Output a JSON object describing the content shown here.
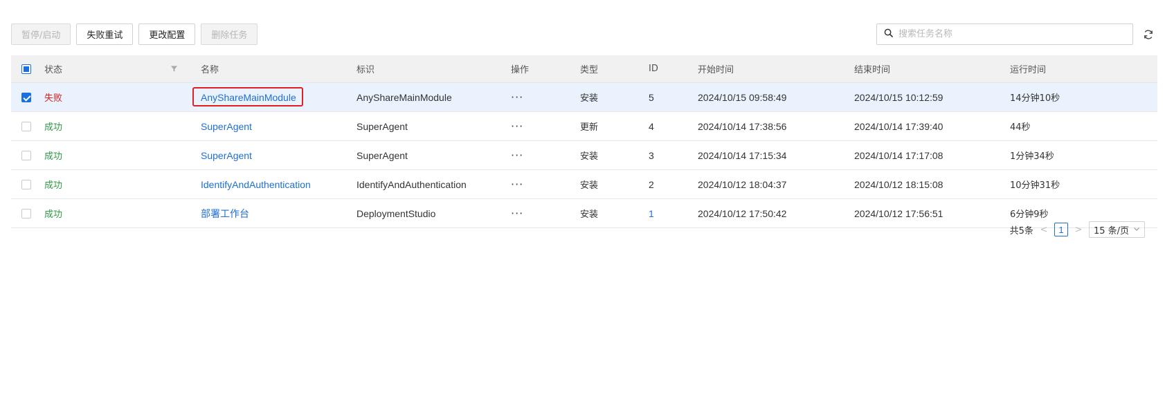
{
  "toolbar": {
    "pause_start_label": "暂停/启动",
    "retry_failed_label": "失败重试",
    "change_config_label": "更改配置",
    "delete_task_label": "删除任务"
  },
  "search": {
    "placeholder": "搜索任务名称",
    "icon": "search-icon"
  },
  "refresh_icon": "refresh-icon",
  "table": {
    "headers": {
      "status": "状态",
      "name": "名称",
      "tag": "标识",
      "operation": "操作",
      "type": "类型",
      "id": "ID",
      "start_time": "开始时间",
      "end_time": "结束时间",
      "run_time": "运行时间"
    },
    "rows": [
      {
        "checked": true,
        "status": "失败",
        "status_kind": "fail",
        "name": "AnyShareMainModule",
        "tag": "AnyShareMainModule",
        "operation": "···",
        "type": "安装",
        "id": "5",
        "start_time": "2024/10/15 09:58:49",
        "end_time": "2024/10/15 10:12:59",
        "run_time": "14分钟10秒"
      },
      {
        "checked": false,
        "status": "成功",
        "status_kind": "ok",
        "name": "SuperAgent",
        "tag": "SuperAgent",
        "operation": "···",
        "type": "更新",
        "id": "4",
        "start_time": "2024/10/14 17:38:56",
        "end_time": "2024/10/14 17:39:40",
        "run_time": "44秒"
      },
      {
        "checked": false,
        "status": "成功",
        "status_kind": "ok",
        "name": "SuperAgent",
        "tag": "SuperAgent",
        "operation": "···",
        "type": "安装",
        "id": "3",
        "start_time": "2024/10/14 17:15:34",
        "end_time": "2024/10/14 17:17:08",
        "run_time": "1分钟34秒"
      },
      {
        "checked": false,
        "status": "成功",
        "status_kind": "ok",
        "name": "IdentifyAndAuthentication",
        "tag": "IdentifyAndAuthentication",
        "operation": "···",
        "type": "安装",
        "id": "2",
        "start_time": "2024/10/12 18:04:37",
        "end_time": "2024/10/12 18:15:08",
        "run_time": "10分钟31秒"
      },
      {
        "checked": false,
        "status": "成功",
        "status_kind": "ok",
        "name": "部署工作台",
        "tag": "DeploymentStudio",
        "operation": "···",
        "type": "安装",
        "id": "1",
        "start_time": "2024/10/12 17:50:42",
        "end_time": "2024/10/12 17:56:51",
        "run_time": "6分钟9秒"
      }
    ]
  },
  "pagination": {
    "total": "共5条",
    "current_page": "1",
    "page_size": "15 条/页"
  },
  "colors": {
    "link": "#1f6ed4",
    "fail": "#e02020",
    "success": "#2e9a45",
    "selected_row_bg": "#eaf2fd",
    "highlight_box": "#e02020"
  }
}
